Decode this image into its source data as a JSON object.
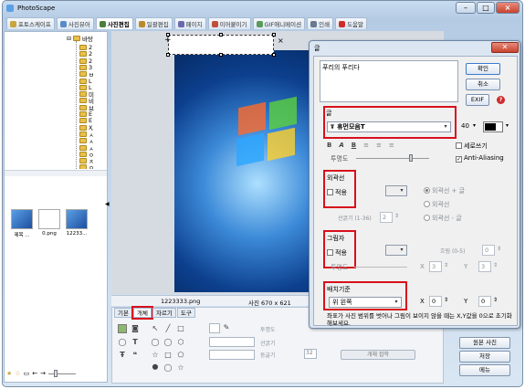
{
  "app": {
    "title": "PhotoScape"
  },
  "tabs": [
    {
      "label": "포토스케이프",
      "color": "#c9a53b"
    },
    {
      "label": "사진뷰어",
      "color": "#5a8bc6"
    },
    {
      "label": "사진편집",
      "color": "#4a7f3a",
      "active": true
    },
    {
      "label": "일괄편집",
      "color": "#b88a2a"
    },
    {
      "label": "페이지",
      "color": "#6a6ab0"
    },
    {
      "label": "이어붙이기",
      "color": "#c0503a"
    },
    {
      "label": "GIF애니메이션",
      "color": "#5a9a5a"
    },
    {
      "label": "인쇄",
      "color": "#6a7890"
    },
    {
      "label": "도움말",
      "color": "#cf2a2a"
    }
  ],
  "tree": {
    "root": "바탕",
    "items": [
      "2",
      "2",
      "2",
      "3",
      "ㅂ",
      "L",
      "L",
      "미",
      "비",
      "브",
      "E",
      "E",
      "Ҳ",
      "ㅅ",
      "ㅅ",
      "ㅅ",
      "ㅇ",
      "ㅈ",
      "ㅇ"
    ]
  },
  "thumbs": [
    {
      "label": "제목 ..."
    },
    {
      "label": "0.png"
    },
    {
      "label": "12233..."
    }
  ],
  "canvas": {
    "filename": "1223333.png",
    "size": "사진 670 x 621"
  },
  "panel": {
    "tabs": [
      {
        "label": "기본"
      },
      {
        "label": "개체",
        "active": true
      },
      {
        "label": "자르기"
      },
      {
        "label": "도구"
      }
    ],
    "opacity_label": "투명도",
    "line_label": "선굵기",
    "round_label": "둥글기",
    "round_value": "32",
    "object_button": "개체 잡학"
  },
  "right_buttons": [
    "원본 사진",
    "저장",
    "메뉴"
  ],
  "dialog": {
    "title": "글",
    "text_value": "푸리의 푸리다",
    "ok": "확인",
    "cancel": "취소",
    "exif": "EXIF",
    "font_section": "글",
    "font_name": "휴먼모음T",
    "font_size": "40",
    "font_color": "#000000",
    "vertical_label": "세로쓰기",
    "opacity_label": "투명도",
    "antialias_label": "Anti-Aliasing",
    "outline_section": "외곽선",
    "outline_apply": "적용",
    "outline_options": [
      "외곽선 + 글",
      "외곽선",
      "외곽선 - 글"
    ],
    "outline_width_label": "선굵기 (1-36)",
    "outline_width_value": "2",
    "shadow_section": "그림자",
    "shadow_apply": "적용",
    "shadow_blur_label": "흐림 (0-5)",
    "shadow_blur_value": "0",
    "shadow_opacity_label": "투명도",
    "shadow_x_label": "X",
    "shadow_x_value": "3",
    "shadow_y_label": "Y",
    "shadow_y_value": "3",
    "position_section": "배치기준",
    "position_value": "위 왼쪽",
    "pos_x_label": "X",
    "pos_x_value": "0",
    "pos_y_label": "Y",
    "pos_y_value": "0",
    "note": "좌표가 사진 범위를 벗어나 그림이 보이지 않을 때는 X,Y값을 0으로 초기화 해보세요."
  }
}
